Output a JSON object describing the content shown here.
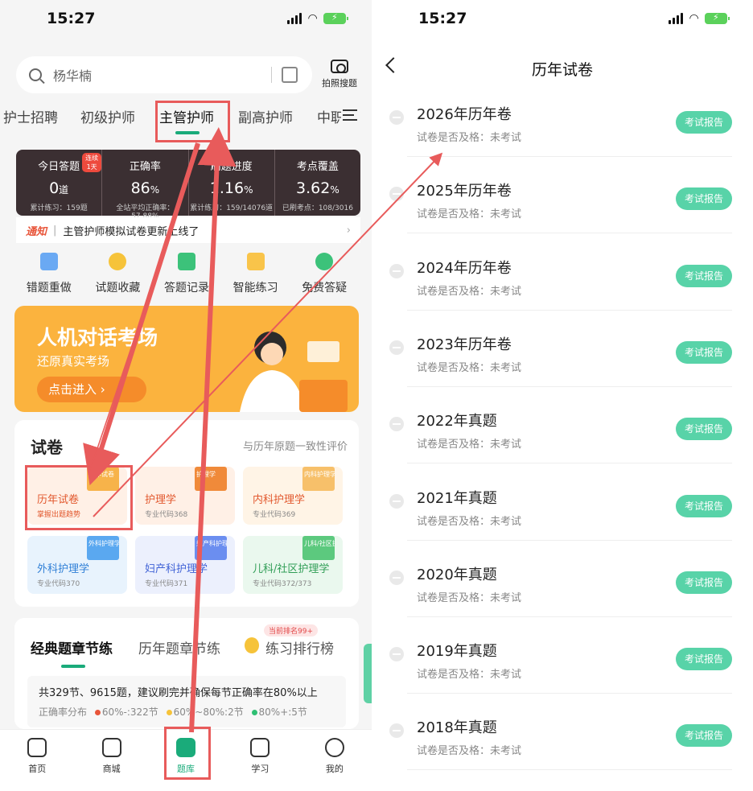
{
  "left": {
    "status": {
      "time": "15:27"
    },
    "search": {
      "placeholder": "杨华楠",
      "photo_label": "拍照搜题"
    },
    "categories": [
      "护士招聘",
      "初级护师",
      "主管护师",
      "副高护师",
      "中职"
    ],
    "stats": [
      {
        "label": "今日答题",
        "value": "0",
        "unit": "道",
        "sub": "累计练习：159题",
        "badge": "连续1天"
      },
      {
        "label": "正确率",
        "value": "86",
        "unit": "%",
        "sub": "全站平均正确率：57.88%"
      },
      {
        "label": "刷题进度",
        "value": "1.16",
        "unit": "%",
        "sub": "累计练习：159/14076道"
      },
      {
        "label": "考点覆盖",
        "value": "3.62",
        "unit": "%",
        "sub": "已刷考点：108/3016"
      }
    ],
    "notice": {
      "tag": "通知",
      "text": "主管护师模拟试卷更新上线了"
    },
    "tools": [
      "错题重做",
      "试题收藏",
      "答题记录",
      "智能练习",
      "免费答疑"
    ],
    "banner": {
      "title": "人机对话考场",
      "subtitle": "还原真实考场",
      "button": "点击进入"
    },
    "papers": {
      "title": "试卷",
      "right": "与历年原题一致性评价",
      "cards": [
        {
          "name": "历年试卷",
          "sub": "掌握出题趋势",
          "book": "历年试卷"
        },
        {
          "name": "护理学",
          "sub": "专业代码368",
          "book": "护理学"
        },
        {
          "name": "内科护理学",
          "sub": "专业代码369",
          "book": "内科护理学"
        },
        {
          "name": "外科护理学",
          "sub": "专业代码370",
          "book": "外科护理学"
        },
        {
          "name": "妇产科护理学",
          "sub": "专业代码371",
          "book": "妇产科护理学"
        },
        {
          "name": "儿科/社区护理学",
          "sub": "专业代码372/373",
          "book": "儿科/社区护理学"
        }
      ]
    },
    "section": {
      "tabs": [
        "经典题章节练",
        "历年题章节练",
        "练习排行榜"
      ],
      "rank_badge": "当前排名99+",
      "info": "共329节、9615题，建议刷完并确保每节正确率在80%以上",
      "dist_label": "正确率分布",
      "dist": [
        "60%-:322节",
        "60%~80%:2节",
        "80%+:5节"
      ]
    },
    "nav": [
      "首页",
      "商城",
      "题库",
      "学习",
      "我的"
    ]
  },
  "right": {
    "status": {
      "time": "15:27"
    },
    "title": "历年试卷",
    "items": [
      {
        "name": "2026年历年卷",
        "status": "试卷是否及格：未考试",
        "button": "考试报告"
      },
      {
        "name": "2025年历年卷",
        "status": "试卷是否及格：未考试",
        "button": "考试报告"
      },
      {
        "name": "2024年历年卷",
        "status": "试卷是否及格：未考试",
        "button": "考试报告"
      },
      {
        "name": "2023年历年卷",
        "status": "试卷是否及格：未考试",
        "button": "考试报告"
      },
      {
        "name": "2022年真题",
        "status": "试卷是否及格：未考试",
        "button": "考试报告"
      },
      {
        "name": "2021年真题",
        "status": "试卷是否及格：未考试",
        "button": "考试报告"
      },
      {
        "name": "2020年真题",
        "status": "试卷是否及格：未考试",
        "button": "考试报告"
      },
      {
        "name": "2019年真题",
        "status": "试卷是否及格：未考试",
        "button": "考试报告"
      },
      {
        "name": "2018年真题",
        "status": "试卷是否及格：未考试",
        "button": "考试报告"
      }
    ]
  },
  "colors": {
    "accent": "#1aab7a",
    "button": "#58d3a8",
    "annotation": "#e85b5b",
    "banner": "#fbb33e"
  }
}
